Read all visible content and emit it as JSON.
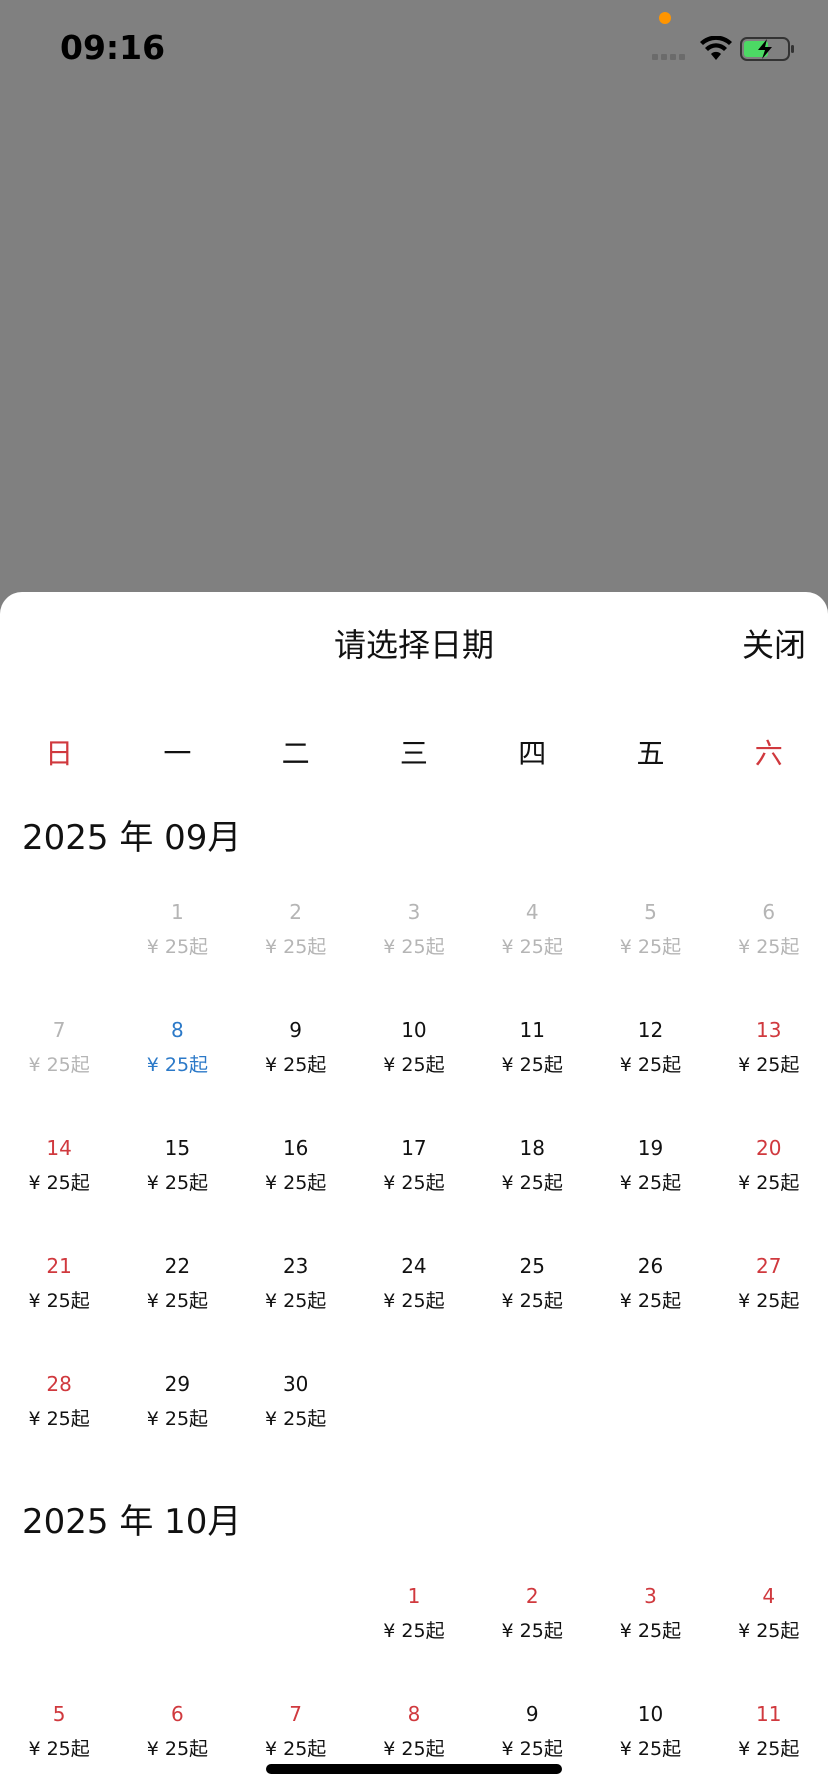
{
  "status_bar": {
    "time": "09:16",
    "colors": {
      "dot": "#ff9500",
      "battery_fill": "#4cd964"
    }
  },
  "sheet": {
    "title": "请选择日期",
    "close_label": "关闭"
  },
  "weekdays": [
    "日",
    "一",
    "二",
    "三",
    "四",
    "五",
    "六"
  ],
  "price_label": "¥ 25起",
  "months": [
    {
      "title": "2025 年 09月",
      "weeks": [
        [
          "",
          "1",
          "2",
          "3",
          "4",
          "5",
          "6"
        ],
        [
          "7",
          "8",
          "9",
          "10",
          "11",
          "12",
          "13"
        ],
        [
          "14",
          "15",
          "16",
          "17",
          "18",
          "19",
          "20"
        ],
        [
          "21",
          "22",
          "23",
          "24",
          "25",
          "26",
          "27"
        ],
        [
          "28",
          "29",
          "30",
          "",
          "",
          "",
          ""
        ]
      ],
      "past_days": [
        "1",
        "2",
        "3",
        "4",
        "5",
        "6",
        "7"
      ],
      "selected_day": "8"
    },
    {
      "title": "2025 年 10月",
      "weeks": [
        [
          "",
          "",
          "",
          "1",
          "2",
          "3",
          "4"
        ],
        [
          "5",
          "6",
          "7",
          "8",
          "9",
          "10",
          "11"
        ]
      ],
      "holiday_days": [
        "1",
        "2",
        "3",
        "4",
        "5",
        "6",
        "7",
        "8"
      ],
      "past_days": [],
      "selected_day": ""
    }
  ],
  "colors": {
    "weekend": "#d0393e",
    "past": "#b5b5b5",
    "selected": "#2b79c8",
    "overlay": "#808080"
  }
}
